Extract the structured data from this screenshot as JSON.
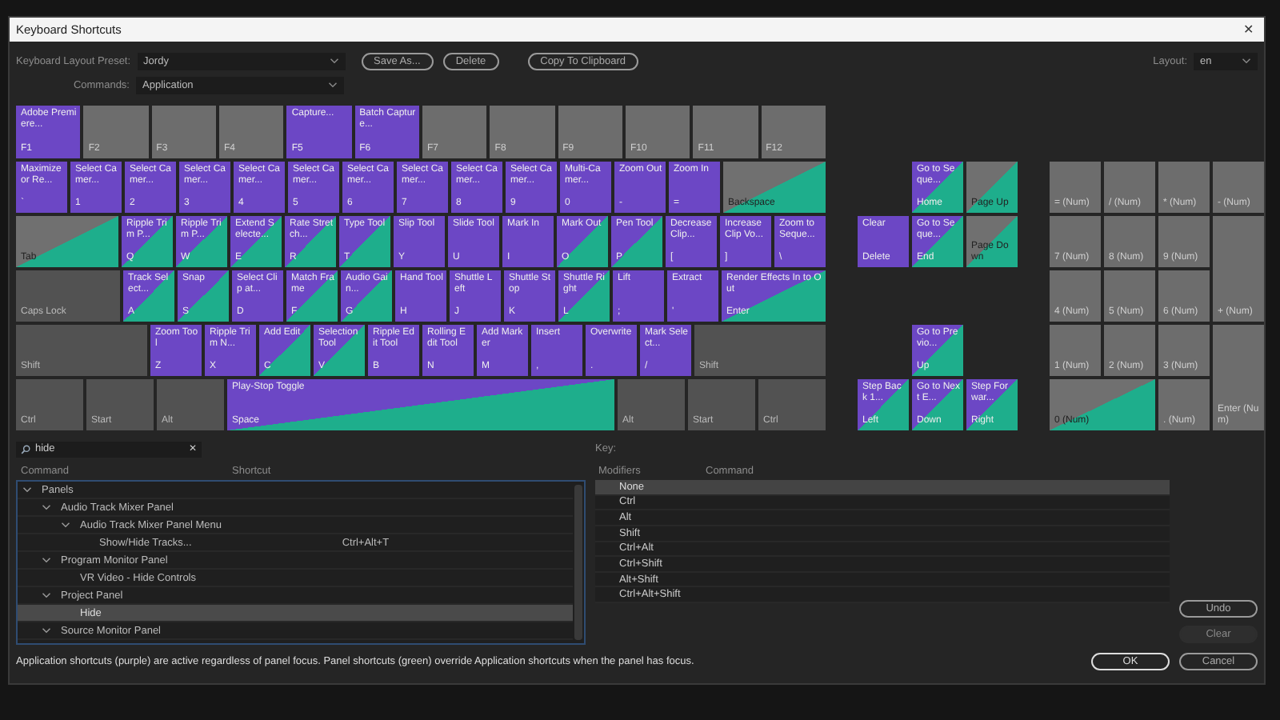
{
  "window": {
    "title": "Keyboard Shortcuts",
    "close": "✕"
  },
  "preset": {
    "label": "Keyboard Layout Preset:",
    "value": "Jordy"
  },
  "buttons_top": [
    "Save As...",
    "Delete",
    "Copy To Clipboard"
  ],
  "layout": {
    "label": "Layout:",
    "value": "en"
  },
  "commands": {
    "label": "Commands:",
    "value": "Application"
  },
  "keyboard_rows": [
    [
      {
        "key": "F1",
        "command": "Adobe Premiere...",
        "kind": "app"
      },
      {
        "key": "F2",
        "kind": "none"
      },
      {
        "key": "F3",
        "kind": "none"
      },
      {
        "key": "F4",
        "kind": "none"
      },
      {
        "key": "F5",
        "command": "Capture...",
        "kind": "app"
      },
      {
        "key": "F6",
        "command": "Batch Capture...",
        "kind": "app"
      },
      {
        "key": "F7",
        "kind": "none"
      },
      {
        "key": "F8",
        "kind": "none"
      },
      {
        "key": "F9",
        "kind": "none"
      },
      {
        "key": "F10",
        "kind": "none"
      },
      {
        "key": "F11",
        "kind": "none"
      },
      {
        "key": "F12",
        "kind": "none"
      }
    ],
    [
      {
        "key": "`",
        "command": "Maximize or Re...",
        "kind": "app"
      },
      {
        "key": "1",
        "command": "Select Camer...",
        "kind": "app"
      },
      {
        "key": "2",
        "command": "Select Camer...",
        "kind": "app"
      },
      {
        "key": "3",
        "command": "Select Camer...",
        "kind": "app"
      },
      {
        "key": "4",
        "command": "Select Camer...",
        "kind": "app"
      },
      {
        "key": "5",
        "command": "Select Camer...",
        "kind": "app"
      },
      {
        "key": "6",
        "command": "Select Camer...",
        "kind": "app"
      },
      {
        "key": "7",
        "command": "Select Camer...",
        "kind": "app"
      },
      {
        "key": "8",
        "command": "Select Camer...",
        "kind": "app"
      },
      {
        "key": "9",
        "command": "Select Camer...",
        "kind": "app"
      },
      {
        "key": "0",
        "command": "Multi-Camer...",
        "kind": "app"
      },
      {
        "key": "-",
        "command": "Zoom Out",
        "kind": "app"
      },
      {
        "key": "=",
        "command": "Zoom In",
        "kind": "app"
      },
      {
        "key": "Backspace",
        "kind": "gray-panel"
      }
    ],
    [
      {
        "key": "Tab",
        "kind": "gray-panel"
      },
      {
        "key": "Q",
        "command": "Ripple Trim P...",
        "kind": "mixed"
      },
      {
        "key": "W",
        "command": "Ripple Trim P...",
        "kind": "mixed"
      },
      {
        "key": "E",
        "command": "Extend Selecte...",
        "kind": "mixed"
      },
      {
        "key": "R",
        "command": "Rate Stretch...",
        "kind": "mixed"
      },
      {
        "key": "T",
        "command": "Type Tool",
        "kind": "mixed"
      },
      {
        "key": "Y",
        "command": "Slip Tool",
        "kind": "app"
      },
      {
        "key": "U",
        "command": "Slide Tool",
        "kind": "app"
      },
      {
        "key": "I",
        "command": "Mark In",
        "kind": "app"
      },
      {
        "key": "O",
        "command": "Mark Out",
        "kind": "mixed"
      },
      {
        "key": "P",
        "command": "Pen Tool",
        "kind": "mixed"
      },
      {
        "key": "[",
        "command": "Decrease Clip...",
        "kind": "app"
      },
      {
        "key": "]",
        "command": "Increase Clip Vo...",
        "kind": "app"
      },
      {
        "key": "\\",
        "command": "Zoom to Seque...",
        "kind": "app"
      }
    ],
    [
      {
        "key": "Caps Lock",
        "kind": "modifier"
      },
      {
        "key": "A",
        "command": "Track Select...",
        "kind": "mixed"
      },
      {
        "key": "S",
        "command": "Snap",
        "kind": "mixed"
      },
      {
        "key": "D",
        "command": "Select Clip at...",
        "kind": "app"
      },
      {
        "key": "F",
        "command": "Match Frame",
        "kind": "mixed"
      },
      {
        "key": "G",
        "command": "Audio Gain...",
        "kind": "mixed"
      },
      {
        "key": "H",
        "command": "Hand Tool",
        "kind": "app"
      },
      {
        "key": "J",
        "command": "Shuttle Left",
        "kind": "app"
      },
      {
        "key": "K",
        "command": "Shuttle Stop",
        "kind": "app"
      },
      {
        "key": "L",
        "command": "Shuttle Right",
        "kind": "mixed"
      },
      {
        "key": ";",
        "command": "Lift",
        "kind": "app"
      },
      {
        "key": "'",
        "command": "Extract",
        "kind": "app"
      },
      {
        "key": "Enter",
        "command": "Render Effects In to Out",
        "kind": "mixed"
      }
    ],
    [
      {
        "key": "Shift",
        "kind": "modifier"
      },
      {
        "key": "Z",
        "command": "Zoom Tool",
        "kind": "app"
      },
      {
        "key": "X",
        "command": "Ripple Trim N...",
        "kind": "app"
      },
      {
        "key": "C",
        "command": "Add Edit",
        "kind": "mixed"
      },
      {
        "key": "V",
        "command": "Selection Tool",
        "kind": "mixed"
      },
      {
        "key": "B",
        "command": "Ripple Edit Tool",
        "kind": "app"
      },
      {
        "key": "N",
        "command": "Rolling Edit Tool",
        "kind": "app"
      },
      {
        "key": "M",
        "command": "Add Marker",
        "kind": "app"
      },
      {
        "key": ",",
        "command": "Insert",
        "kind": "app"
      },
      {
        "key": ".",
        "command": "Overwrite",
        "kind": "app"
      },
      {
        "key": "/",
        "command": "Mark Select...",
        "kind": "app"
      },
      {
        "key": "Shift",
        "kind": "modifier"
      }
    ],
    [
      {
        "key": "Ctrl",
        "kind": "modifier"
      },
      {
        "key": "Start",
        "kind": "modifier"
      },
      {
        "key": "Alt",
        "kind": "modifier"
      },
      {
        "key": "Space",
        "command": "Play-Stop Toggle",
        "kind": "mixed"
      },
      {
        "key": "Alt",
        "kind": "modifier"
      },
      {
        "key": "Start",
        "kind": "modifier"
      },
      {
        "key": "Ctrl",
        "kind": "modifier"
      }
    ]
  ],
  "nav_keys": [
    {
      "key": "Home",
      "command": "Go to Seque...",
      "kind": "mixed"
    },
    {
      "key": "Page Up",
      "kind": "gray-panel"
    },
    {
      "key": "Delete",
      "command": "Clear",
      "kind": "app"
    },
    {
      "key": "End",
      "command": "Go to Seque...",
      "kind": "mixed"
    },
    {
      "key": "Page Down",
      "kind": "gray-panel"
    },
    {
      "key": "Up",
      "command": "Go to Previo...",
      "kind": "mixed"
    },
    {
      "key": "Left",
      "command": "Step Back 1...",
      "kind": "mixed"
    },
    {
      "key": "Down",
      "command": "Go to Next E...",
      "kind": "mixed"
    },
    {
      "key": "Right",
      "command": "Step Forwar...",
      "kind": "mixed"
    }
  ],
  "numpad_keys": [
    {
      "key": "= (Num)",
      "kind": "none"
    },
    {
      "key": "/ (Num)",
      "kind": "none"
    },
    {
      "key": "* (Num)",
      "kind": "none"
    },
    {
      "key": "- (Num)",
      "kind": "none"
    },
    {
      "key": "7 (Num)",
      "kind": "none"
    },
    {
      "key": "8 (Num)",
      "kind": "none"
    },
    {
      "key": "9 (Num)",
      "kind": "none"
    },
    {
      "key": "4 (Num)",
      "kind": "none"
    },
    {
      "key": "5 (Num)",
      "kind": "none"
    },
    {
      "key": "6 (Num)",
      "kind": "none"
    },
    {
      "key": "+ (Num)",
      "kind": "none"
    },
    {
      "key": "1 (Num)",
      "kind": "none"
    },
    {
      "key": "2 (Num)",
      "kind": "none"
    },
    {
      "key": "3 (Num)",
      "kind": "none"
    },
    {
      "key": "0 (Num)",
      "kind": "gray-panel"
    },
    {
      "key": ". (Num)",
      "kind": "none"
    },
    {
      "key": "Enter (Num)",
      "kind": "none"
    }
  ],
  "search": {
    "value": "hide",
    "clear": "✕"
  },
  "key_label": "Key:",
  "command_table": {
    "columns": [
      "Command",
      "Shortcut"
    ],
    "tree": [
      {
        "label": "Panels",
        "expanded": true,
        "selected": false,
        "children": [
          {
            "label": "Audio Track Mixer Panel",
            "expanded": true,
            "selected": false,
            "children": [
              {
                "label": "Audio Track Mixer Panel Menu",
                "expanded": true,
                "selected": false,
                "children": [
                  {
                    "label": "Show/Hide Tracks...",
                    "shortcut": "Ctrl+Alt+T",
                    "selected": false
                  }
                ]
              }
            ]
          },
          {
            "label": "Program Monitor Panel",
            "expanded": true,
            "selected": false,
            "children": [
              {
                "label": "VR Video - Hide Controls",
                "selected": false
              }
            ]
          },
          {
            "label": "Project Panel",
            "expanded": true,
            "selected": false,
            "children": [
              {
                "label": "Hide",
                "selected": true
              }
            ]
          },
          {
            "label": "Source Monitor Panel",
            "expanded": true,
            "selected": false
          }
        ]
      }
    ]
  },
  "modifier_table": {
    "columns": [
      "Modifiers",
      "Command"
    ],
    "rows": [
      {
        "label": "None",
        "selected": true
      },
      {
        "label": "Ctrl",
        "selected": false
      },
      {
        "label": "Alt",
        "selected": false
      },
      {
        "label": "Shift",
        "selected": false
      },
      {
        "label": "Ctrl+Alt",
        "selected": false
      },
      {
        "label": "Ctrl+Shift",
        "selected": false
      },
      {
        "label": "Alt+Shift",
        "selected": false
      },
      {
        "label": "Ctrl+Alt+Shift",
        "selected": false
      }
    ]
  },
  "side_buttons": [
    {
      "label": "Undo",
      "disabled": false
    },
    {
      "label": "Clear",
      "disabled": true
    }
  ],
  "footer_note": "Application shortcuts (purple) are active regardless of panel focus. Panel shortcuts (green) override Application shortcuts when the panel has focus.",
  "footer_buttons": [
    "OK",
    "Cancel"
  ]
}
